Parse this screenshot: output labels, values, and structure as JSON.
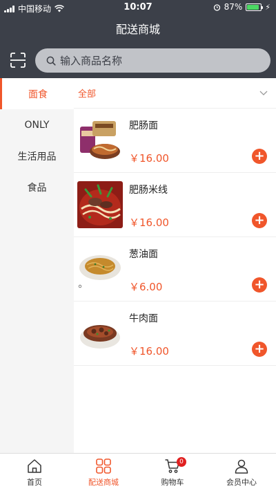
{
  "status_bar": {
    "carrier": "中国移动",
    "time": "10:07",
    "battery": "87%",
    "battery_level": 0.87
  },
  "header": {
    "title": "配送商城"
  },
  "search": {
    "placeholder": "输入商品名称"
  },
  "sidebar": {
    "items": [
      {
        "label": "面食",
        "active": true
      },
      {
        "label": "ONLY",
        "active": false
      },
      {
        "label": "生活用品",
        "active": false
      },
      {
        "label": "食品",
        "active": false
      }
    ]
  },
  "filter": {
    "label": "全部"
  },
  "products": [
    {
      "name": "肥肠面",
      "price": "￥16.00"
    },
    {
      "name": "肥肠米线",
      "price": "￥16.00"
    },
    {
      "name": "葱油面",
      "price": "￥6.00"
    },
    {
      "name": "牛肉面",
      "price": "￥16.00"
    }
  ],
  "tabbar": {
    "tabs": [
      {
        "label": "首页",
        "icon": "home-icon"
      },
      {
        "label": "配送商城",
        "icon": "grid-icon",
        "active": true
      },
      {
        "label": "购物车",
        "icon": "cart-icon",
        "badge": "0"
      },
      {
        "label": "会员中心",
        "icon": "user-icon"
      }
    ]
  },
  "colors": {
    "accent": "#f0562b",
    "header_bg": "#3c4049",
    "sidebar_bg": "#f5f5f5"
  }
}
